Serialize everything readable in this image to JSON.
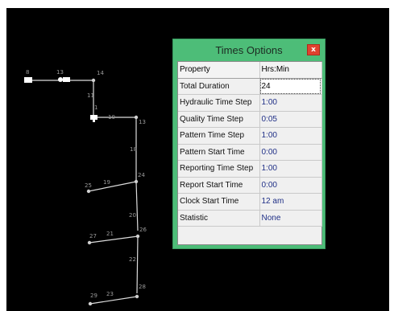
{
  "network": {
    "nodes": [
      "8",
      "13",
      "14",
      "11",
      "1",
      "10",
      "13",
      "18",
      "25",
      "19",
      "24",
      "20",
      "27",
      "21",
      "26",
      "22",
      "29",
      "23",
      "28"
    ]
  },
  "dialog": {
    "title": "Times Options",
    "close_glyph": "x",
    "columns": [
      "Property",
      "Hrs:Min"
    ],
    "rows": [
      {
        "property": "Total Duration",
        "value": "24"
      },
      {
        "property": "Hydraulic Time Step",
        "value": "1:00"
      },
      {
        "property": "Quality Time Step",
        "value": "0:05"
      },
      {
        "property": "Pattern Time Step",
        "value": "1:00"
      },
      {
        "property": "Pattern Start Time",
        "value": "0:00"
      },
      {
        "property": "Reporting Time Step",
        "value": "1:00"
      },
      {
        "property": "Report Start Time",
        "value": "0:00"
      },
      {
        "property": "Clock Start Time",
        "value": "12 am"
      },
      {
        "property": "Statistic",
        "value": "None"
      }
    ]
  },
  "colors": {
    "canvas": "#000000",
    "dialog_frame": "#4dbd78",
    "close_button": "#e0412f",
    "value_text": "#1f2f86"
  }
}
